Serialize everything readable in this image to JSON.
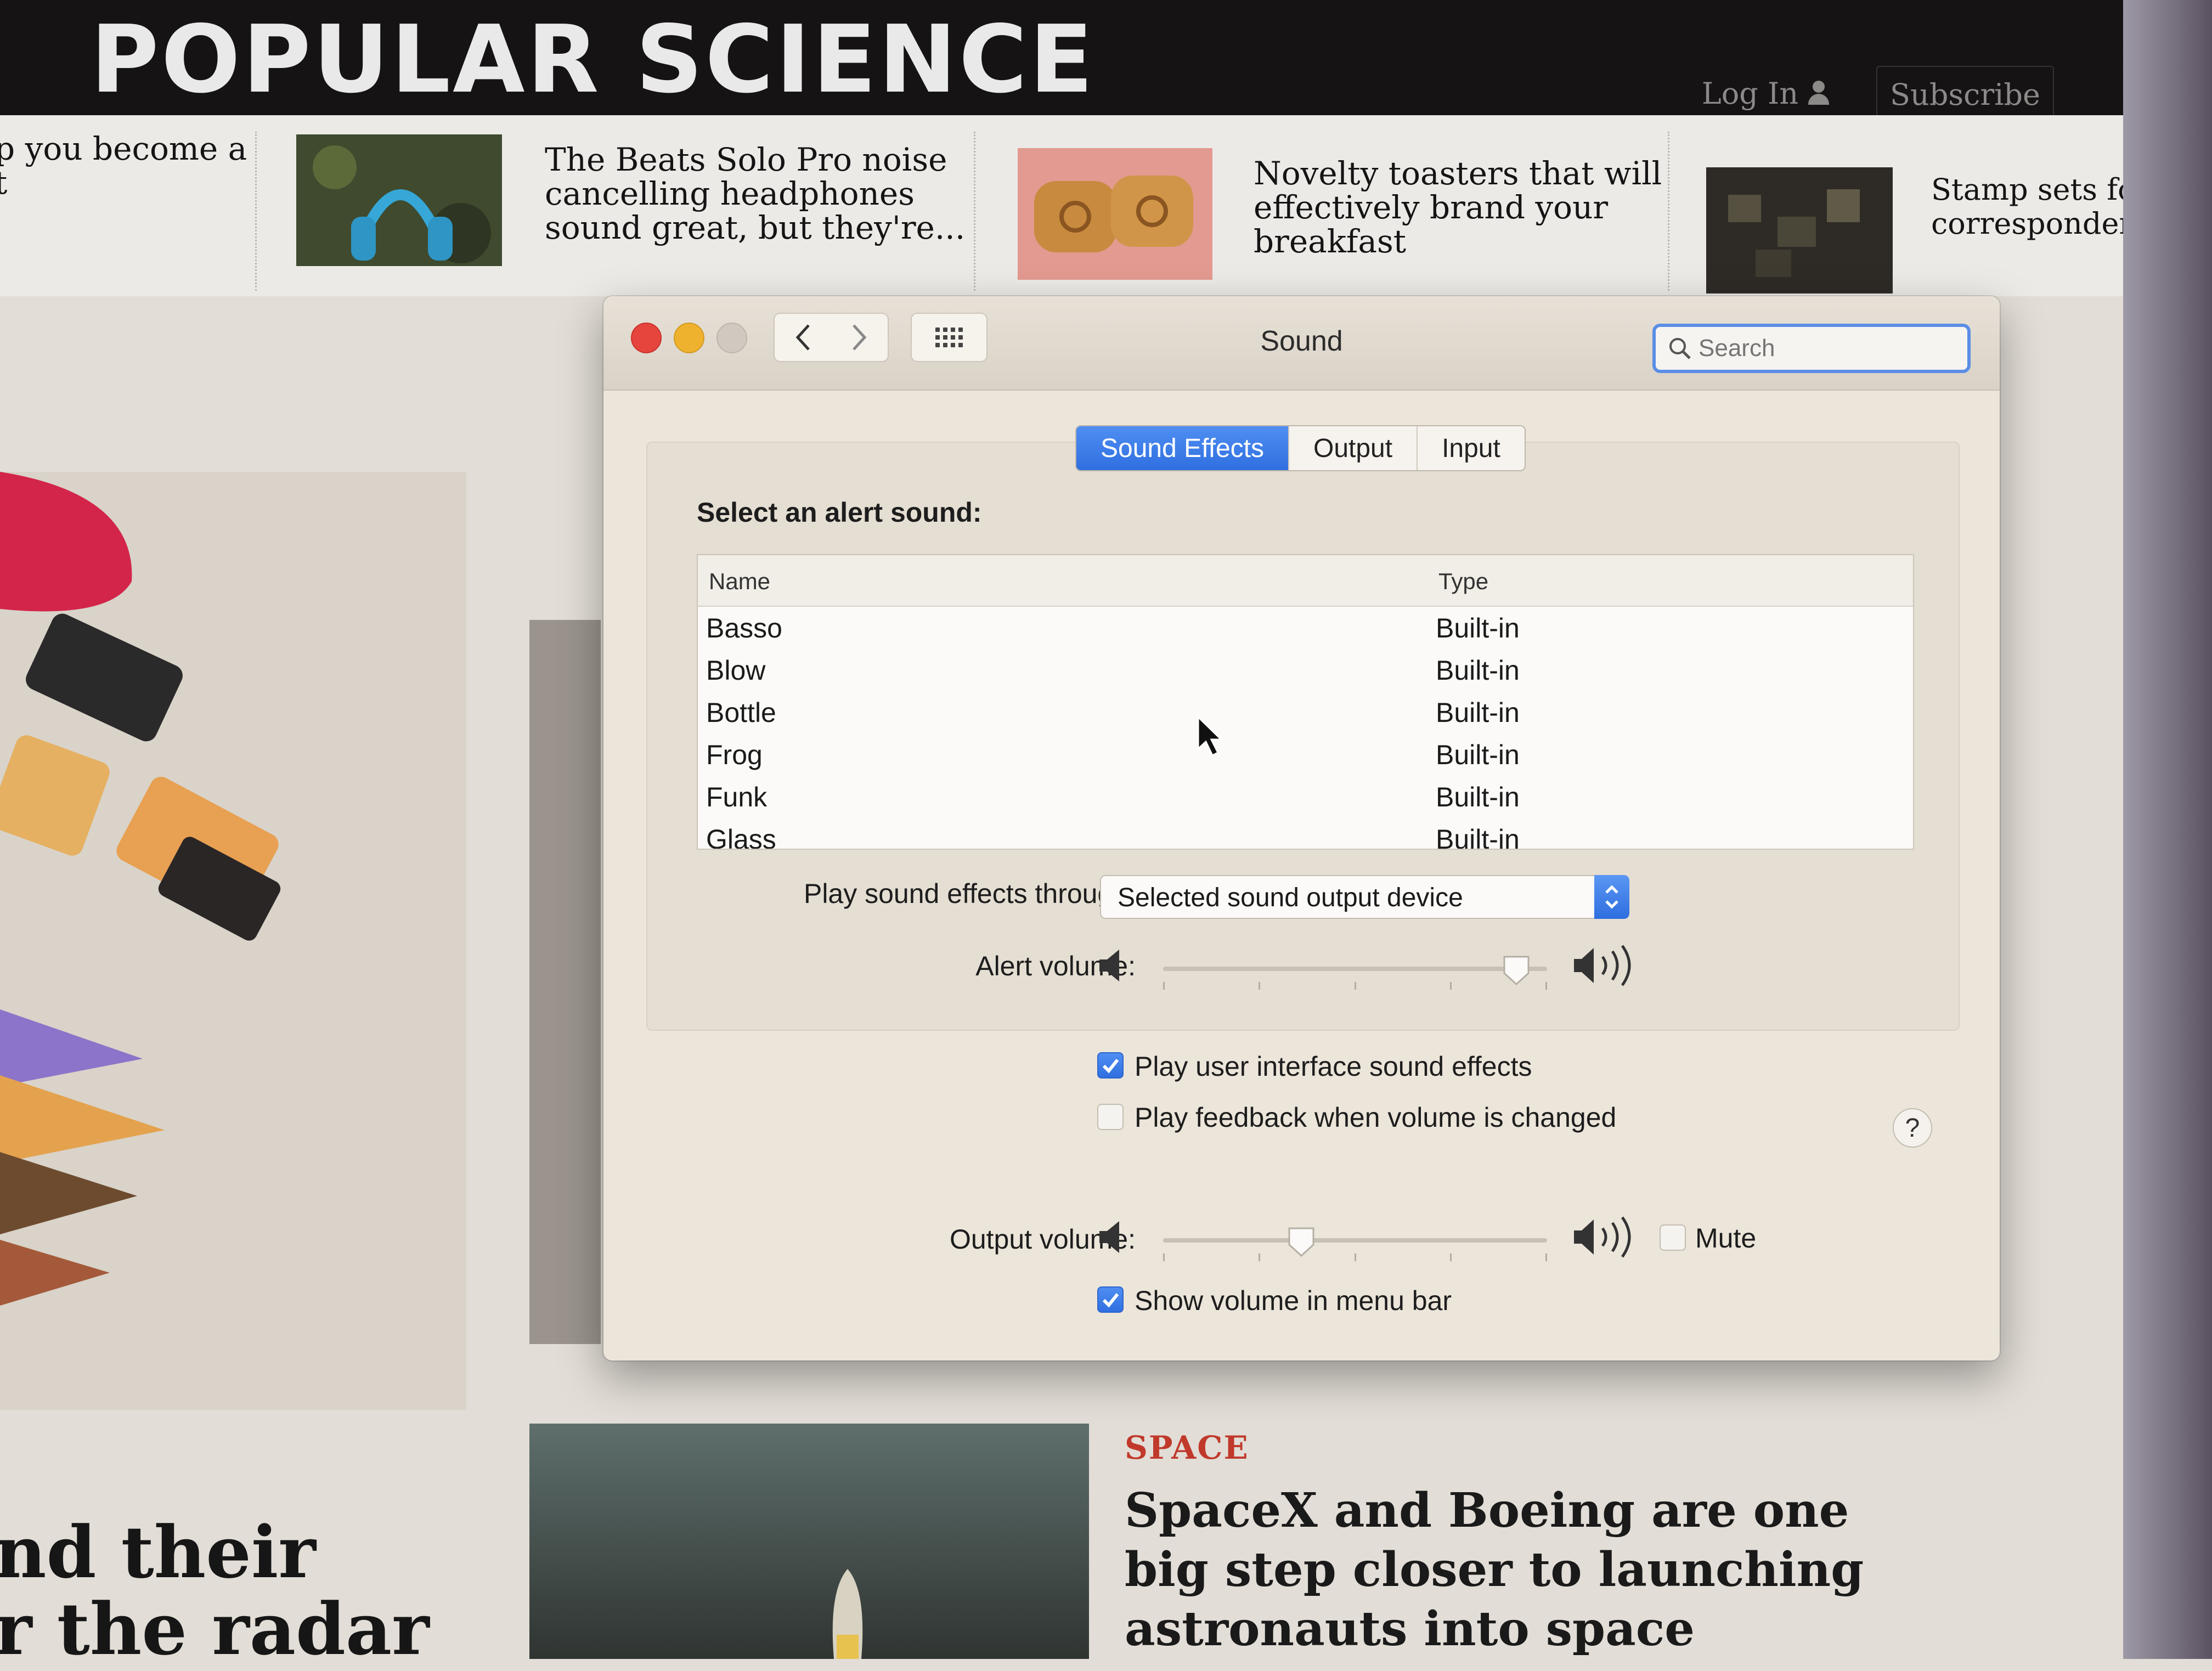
{
  "site": {
    "logo": "POPULAR SCIENCE",
    "login": "Log In",
    "subscribe": "Subscribe",
    "teasers": [
      {
        "text": "p you become a\nt"
      },
      {
        "text": "The Beats Solo Pro noise\ncancelling headphones\nsound great, but they're..."
      },
      {
        "text": "Novelty toasters that will\neffectively brand your\nbreakfast"
      },
      {
        "text": "Stamp sets for\ncorrespondenc"
      }
    ],
    "space_section": "SPACE",
    "space_headline": "SpaceX and Boeing are one big step closer to launching astronauts into space",
    "left_headline_line1": "nd their",
    "left_headline_line2": "r the radar"
  },
  "window": {
    "title": "Sound",
    "search_placeholder": "Search",
    "tabs": [
      {
        "label": "Sound Effects",
        "active": true
      },
      {
        "label": "Output",
        "active": false
      },
      {
        "label": "Input",
        "active": false
      }
    ],
    "alert_heading": "Select an alert sound:",
    "table": {
      "col_name": "Name",
      "col_type": "Type",
      "rows": [
        {
          "name": "Basso",
          "type": "Built-in"
        },
        {
          "name": "Blow",
          "type": "Built-in"
        },
        {
          "name": "Bottle",
          "type": "Built-in"
        },
        {
          "name": "Frog",
          "type": "Built-in"
        },
        {
          "name": "Funk",
          "type": "Built-in"
        },
        {
          "name": "Glass",
          "type": "Built-in"
        }
      ]
    },
    "play_through_label": "Play sound effects through:",
    "play_through_value": "Selected sound output device",
    "alert_volume_label": "Alert volume:",
    "alert_volume_level": 0.92,
    "ui_sounds_label": "Play user interface sound effects",
    "ui_sounds_checked": true,
    "feedback_label": "Play feedback when volume is changed",
    "feedback_checked": false,
    "help": "?",
    "output_volume_label": "Output volume:",
    "output_volume_level": 0.36,
    "mute_label": "Mute",
    "mute_checked": false,
    "menu_bar_label": "Show volume in menu bar",
    "menu_bar_checked": true
  },
  "colors": {
    "accent": "#2f6fe0",
    "close": "#e6453d",
    "minimize": "#efb22f",
    "section_red": "#c0392b"
  }
}
